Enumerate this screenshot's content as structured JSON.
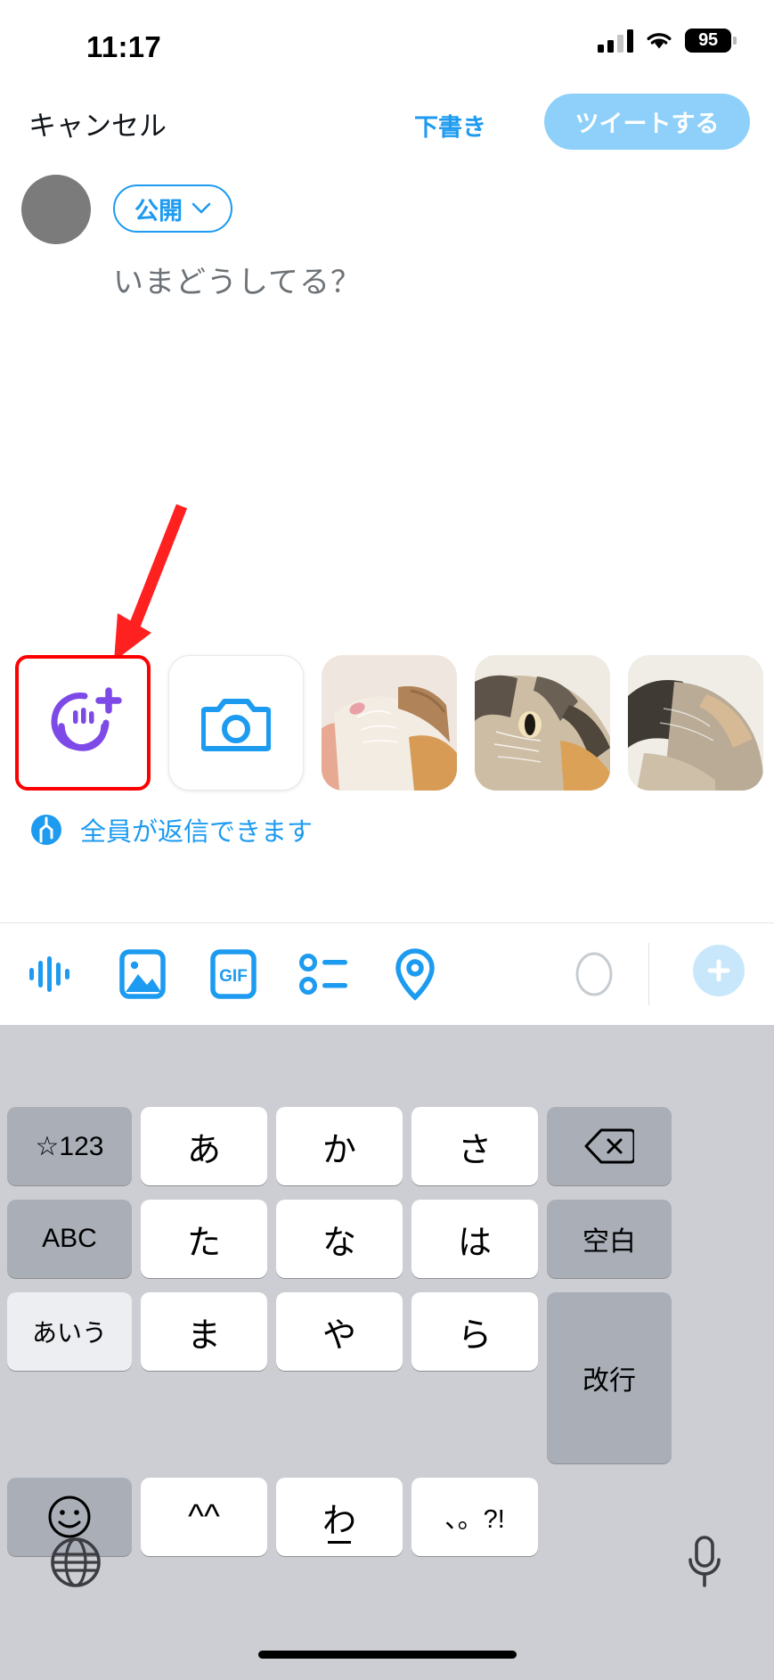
{
  "status_bar": {
    "time": "11:17",
    "battery_level": "95",
    "icons": [
      "signal-bars-icon",
      "wifi-icon",
      "battery-icon"
    ]
  },
  "nav_bar": {
    "cancel_label": "キャンセル",
    "draft_label": "下書き",
    "tweet_label": "ツイートする",
    "tweet_button_color": "#8ed0f9",
    "accent_color": "#1d9bf0"
  },
  "composer": {
    "audience_label": "公開",
    "placeholder": "いまどうしてる？",
    "avatar_color": "#7b7b7b"
  },
  "media_tray": {
    "tiles": [
      {
        "name": "memoji-sticker-button",
        "icon": "memoji-plus-icon",
        "color": "#7d4ae8",
        "highlighted": true
      },
      {
        "name": "camera-button",
        "icon": "camera-icon",
        "color": "#1d9bf0",
        "highlighted": false
      }
    ],
    "photos": [
      {
        "name": "photo-thumbnail-1",
        "alt": "cat-photo"
      },
      {
        "name": "photo-thumbnail-2",
        "alt": "cat-photo"
      },
      {
        "name": "photo-thumbnail-3",
        "alt": "cat-photo"
      }
    ],
    "highlight_color": "#ff0000"
  },
  "reply_row": {
    "icon": "globe-icon",
    "label": "全員が返信できます",
    "color": "#1d9bf0"
  },
  "toolbar": {
    "items": [
      {
        "name": "audio-button",
        "icon": "waveform-icon"
      },
      {
        "name": "media-button",
        "icon": "image-icon"
      },
      {
        "name": "gif-button",
        "icon": "gif-icon",
        "label": "GIF"
      },
      {
        "name": "poll-button",
        "icon": "poll-list-icon"
      },
      {
        "name": "location-button",
        "icon": "location-pin-icon"
      }
    ],
    "char_counter": "",
    "add_label": "+",
    "color": "#1d9bf0"
  },
  "keyboard": {
    "rows": [
      [
        {
          "name": "key-numbers",
          "label": "☆123",
          "type": "side"
        },
        {
          "name": "key-a",
          "label": "あ",
          "type": "kana"
        },
        {
          "name": "key-ka",
          "label": "か",
          "type": "kana"
        },
        {
          "name": "key-sa",
          "label": "さ",
          "type": "kana"
        },
        {
          "name": "key-backspace",
          "label": "",
          "type": "side",
          "icon": "backspace-icon"
        }
      ],
      [
        {
          "name": "key-abc",
          "label": "ABC",
          "type": "side"
        },
        {
          "name": "key-ta",
          "label": "た",
          "type": "kana"
        },
        {
          "name": "key-na",
          "label": "な",
          "type": "kana"
        },
        {
          "name": "key-ha",
          "label": "は",
          "type": "kana"
        },
        {
          "name": "key-space",
          "label": "空白",
          "type": "side"
        }
      ],
      [
        {
          "name": "key-aiu",
          "label": "あいう",
          "type": "side-light"
        },
        {
          "name": "key-ma",
          "label": "ま",
          "type": "kana"
        },
        {
          "name": "key-ya",
          "label": "や",
          "type": "kana"
        },
        {
          "name": "key-ra",
          "label": "ら",
          "type": "kana"
        },
        {
          "name": "key-return",
          "label": "改行",
          "type": "side-tall"
        }
      ],
      [
        {
          "name": "key-emoji",
          "label": "",
          "type": "side",
          "icon": "smiley-icon"
        },
        {
          "name": "key-kaomoji",
          "label": "^^",
          "type": "kana"
        },
        {
          "name": "key-wa",
          "label": "わ",
          "type": "kana-underline"
        },
        {
          "name": "key-punct",
          "label": "、。?!",
          "type": "kana-small"
        }
      ]
    ],
    "bottom": {
      "globe": "globe-keyboard-icon",
      "mic": "microphone-icon"
    },
    "background": "#ccced3"
  }
}
